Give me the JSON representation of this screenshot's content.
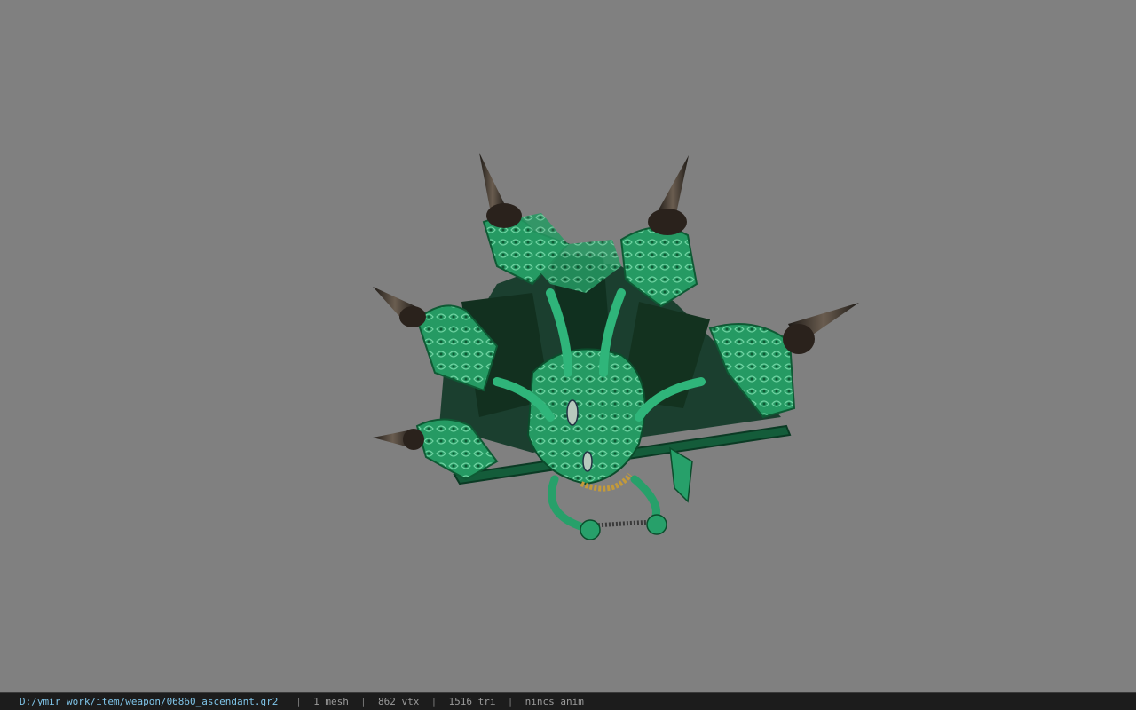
{
  "viewport": {
    "background_color": "#808080",
    "model": {
      "object": "ascendant-fan-weapon",
      "primary_color": "#27a06a",
      "dark_panel_color": "#1a3d2e",
      "spike_color": "#3a3028",
      "gem_color": "#b7c9bd",
      "chain_color": "#c39a3a"
    }
  },
  "status_bar": {
    "file_path": "D:/ymir work/item/weapon/06860_ascendant.gr2",
    "separator": "|",
    "mesh_count": "1 mesh",
    "vertex_count": "862 vtx",
    "triangle_count": "1516 tri",
    "animation": "nincs anim",
    "path_color": "#7fc4e8",
    "text_color": "#9a9a9a"
  }
}
